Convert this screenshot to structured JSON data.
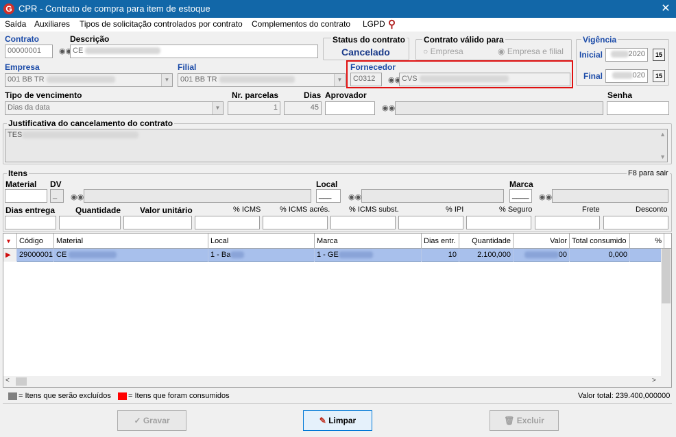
{
  "window": {
    "title": "CPR - Contrato de compra para item de estoque",
    "logo": "G"
  },
  "menu": [
    "Saída",
    "Auxiliares",
    "Tipos de solicitação controlados por contrato",
    "Complementos do contrato",
    "LGPD"
  ],
  "contract": {
    "contrato_label": "Contrato",
    "contrato_value": "00000001",
    "descricao_label": "Descrição",
    "descricao_value": "CE",
    "status_label": "Status do contrato",
    "status_value": "Cancelado",
    "valido_label": "Contrato válido para",
    "opt_empresa": "Empresa",
    "opt_empresa_filial": "Empresa e filial",
    "vigencia_label": "Vigência",
    "inicial_label": "Inicial",
    "inicial_value": "2020",
    "final_label": "Final",
    "final_value": "020",
    "cal_icon_text": "15",
    "empresa_label": "Empresa",
    "empresa_value": "001 BB TR",
    "filial_label": "Filial",
    "filial_value": "001 BB TR",
    "fornecedor_label": "Fornecedor",
    "fornecedor_code": "C0312",
    "fornecedor_name": "CVS",
    "tipo_venc_label": "Tipo de vencimento",
    "tipo_venc_value": "Dias da data",
    "nr_parcelas_label": "Nr. parcelas",
    "nr_parcelas_value": "1",
    "dias_label": "Dias",
    "dias_value": "45",
    "aprovador_label": "Aprovador",
    "senha_label": "Senha",
    "justificativa_label": "Justificativa do cancelamento do contrato",
    "justificativa_value": "TES"
  },
  "items": {
    "label": "Itens",
    "f8_hint": "F8 para sair",
    "material_label": "Material",
    "dv_label": "DV",
    "dv_value": "_",
    "local_label": "Local",
    "marca_label": "Marca",
    "local_value": "___",
    "marca_value": "____",
    "dias_entrega_label": "Dias entrega",
    "quantidade_label": "Quantidade",
    "valor_unitario_label": "Valor unitário",
    "icms_label": "% ICMS",
    "icms_acres_label": "% ICMS acrés.",
    "icms_subst_label": "% ICMS subst.",
    "ipi_label": "% IPI",
    "seguro_label": "% Seguro",
    "frete_label": "Frete",
    "desconto_label": "Desconto"
  },
  "grid": {
    "columns": [
      "Código",
      "Material",
      "Local",
      "Marca",
      "Dias entr.",
      "Quantidade",
      "Valor",
      "Total consumido",
      "%"
    ],
    "rows": [
      {
        "codigo": "29000001",
        "material": "CE",
        "local": "1 - Ba",
        "marca": "1 - GE",
        "dias": "10",
        "quantidade": "2.100,000",
        "valor": "00",
        "total": "0,000"
      }
    ]
  },
  "legend": {
    "excluidos": "= Itens que serão excluídos",
    "consumidos": "= Itens que foram consumidos",
    "total": "Valor total: 239.400,000000",
    "color_gray": "#808080",
    "color_red": "#ff0000"
  },
  "buttons": {
    "gravar": "Gravar",
    "limpar": "Limpar",
    "excluir": "Excluir"
  },
  "colors": {
    "titlebar": "#1267a8",
    "selection": "#a8c0ec",
    "highlight_box": "#e01010",
    "status_text": "#1a3a8a"
  }
}
